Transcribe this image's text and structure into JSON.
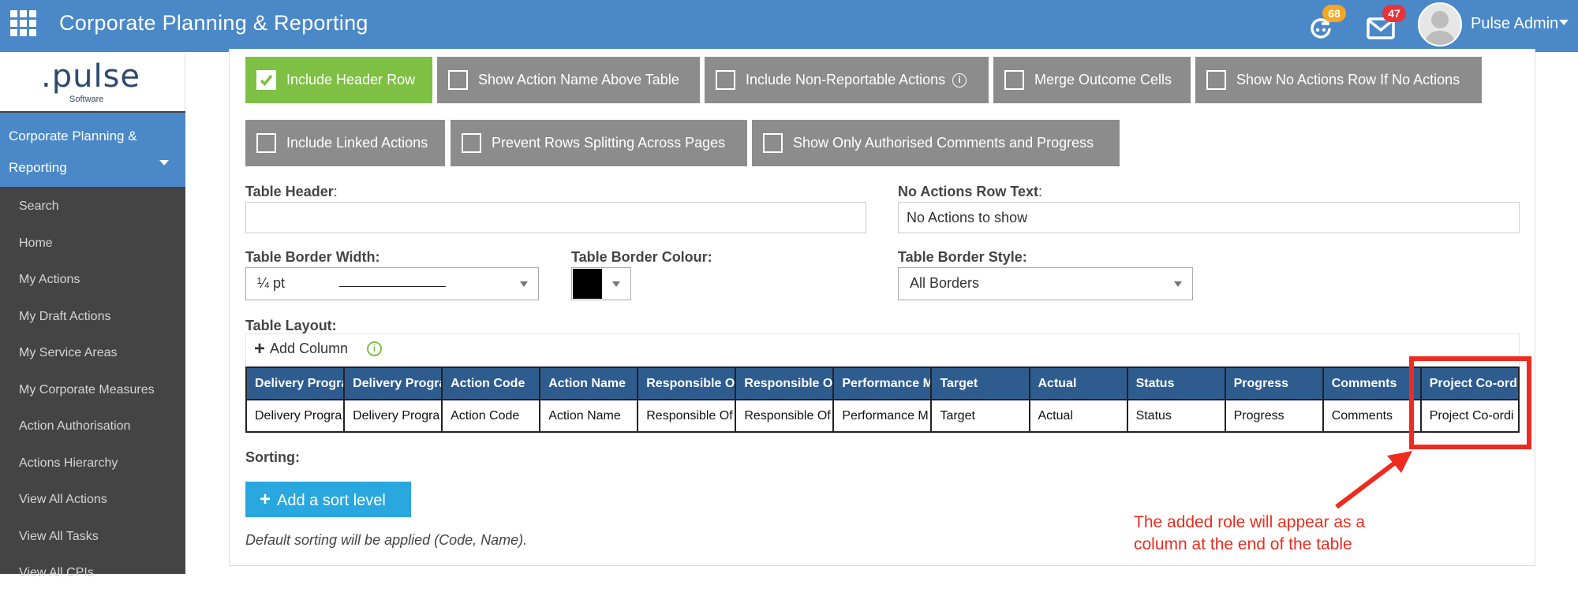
{
  "header": {
    "app_title": "Corporate Planning & Reporting",
    "grid_icon": "apps-grid-icon",
    "refresh_badge": "68",
    "refresh_badge_color": "#f5a623",
    "mail_badge": "47",
    "mail_badge_color": "#e8333a",
    "user_name": "Pulse Admin"
  },
  "sidebar": {
    "logo_main": ".pulse",
    "logo_sub": "Software",
    "module_label": "Corporate Planning & Reporting",
    "items": [
      {
        "label": "Search"
      },
      {
        "label": "Home"
      },
      {
        "label": "My Actions"
      },
      {
        "label": "My Draft Actions"
      },
      {
        "label": "My Service Areas"
      },
      {
        "label": "My Corporate Measures"
      },
      {
        "label": "Action Authorisation"
      },
      {
        "label": "Actions Hierarchy"
      },
      {
        "label": "View All Actions"
      },
      {
        "label": "View All Tasks"
      },
      {
        "label": "View All CPIs"
      }
    ]
  },
  "options": {
    "include_header_row": "Include Header Row",
    "show_action_name": "Show Action Name Above Table",
    "include_non_reportable": "Include Non-Reportable Actions",
    "merge_outcome_cells": "Merge Outcome Cells",
    "show_no_actions_row": "Show No Actions Row If No Actions",
    "include_linked_actions": "Include Linked Actions",
    "prevent_rows_splitting": "Prevent Rows Splitting Across Pages",
    "show_only_authorised": "Show Only Authorised Comments and Progress",
    "info_glyph": "i",
    "checked_state": {
      "include_header_row": true
    }
  },
  "form": {
    "table_header_label": "Table Header",
    "table_header_value": "",
    "no_actions_label": "No Actions Row Text",
    "colon": ":",
    "no_actions_value": "No Actions to show",
    "border_width_label": "Table Border Width:",
    "border_width_value": "¼ pt",
    "border_colour_label": "Table Border Colour:",
    "border_colour_value": "#000000",
    "border_style_label": "Table Border Style:",
    "border_style_value": "All Borders",
    "table_layout_label": "Table Layout:",
    "add_column": "Add Column",
    "info_glyph": "i"
  },
  "table": {
    "headers": [
      "Delivery Progr...",
      "Delivery Progr...",
      "Action Code",
      "Action Name",
      "Responsible O...",
      "Responsible O...",
      "Performance M...",
      "Target",
      "Actual",
      "Status",
      "Progress",
      "Comments",
      "Project Co-ord..."
    ],
    "header_display": [
      "Delivery Progra",
      "Delivery Progra",
      "Action Code",
      "Action Name",
      "Responsible O",
      "Responsible O",
      "Performance M",
      "Target",
      "Actual",
      "Status",
      "Progress",
      "Comments",
      "Project Co-ord"
    ],
    "row": [
      "Delivery Progra",
      "Delivery Progra",
      "Action Code",
      "Action Name",
      "Responsible Of",
      "Responsible Of",
      "Performance M",
      "Target",
      "Actual",
      "Status",
      "Progress",
      "Comments",
      "Project Co-ordi"
    ],
    "header_color": "#2e5c8f"
  },
  "sorting": {
    "label": "Sorting:",
    "add_sort_level": "Add a sort level",
    "default_note": "Default sorting will be applied (Code, Name)."
  },
  "annotation": {
    "text": "The added role will appear as a column at the end of the table",
    "color": "#ee2b1e"
  }
}
